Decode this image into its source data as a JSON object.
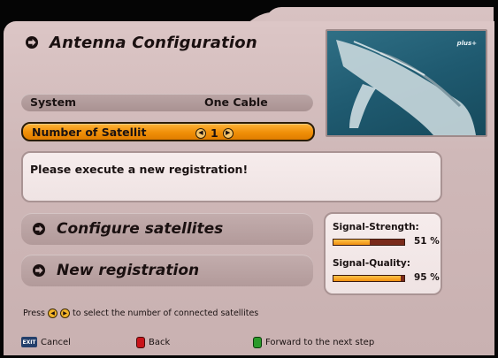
{
  "header": {
    "title": "Antenna Configuration",
    "icon": "arrow-right-icon"
  },
  "preview": {
    "channel_logo": "plus+"
  },
  "settings": {
    "system_label": "System",
    "system_value": "One Cable",
    "satellites_label": "Number of Satellit",
    "satellites_value": "1"
  },
  "message": "Please execute a new registration!",
  "buttons": {
    "configure": "Configure satellites",
    "new_registration": "New registration"
  },
  "signal": {
    "strength_label": "Signal-Strength:",
    "strength_value": "51 %",
    "strength_percent": 51,
    "quality_label": "Signal-Quality:",
    "quality_value": "95 %",
    "quality_percent": 95
  },
  "hint": {
    "prefix": "Press",
    "suffix": "to select the number of connected satellites"
  },
  "footer": {
    "cancel_key": "EXIT",
    "cancel": "Cancel",
    "back": "Back",
    "forward": "Forward to the next step"
  },
  "colors": {
    "accent": "#f09010",
    "panel": "#d4bebe",
    "red_key": "#c8141a",
    "green_key": "#2a9a2a"
  }
}
